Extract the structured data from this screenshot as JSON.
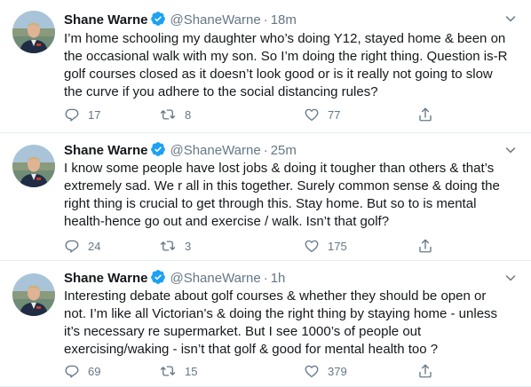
{
  "tweets": [
    {
      "name": "Shane Warne",
      "handle": "@ShaneWarne",
      "separator": "·",
      "time": "18m",
      "lines": [
        "I’m home schooling my daughter who’s doing Y12, stayed home & been on",
        "the occasional walk with my son. So I’m doing the right thing. Question is-R",
        "golf courses closed as it doesn’t look good or is it really not going to slow",
        "the curve if you adhere to the social distancing rules?"
      ],
      "replies": "17",
      "retweets": "8",
      "likes": "77"
    },
    {
      "name": "Shane Warne",
      "handle": "@ShaneWarne",
      "separator": "·",
      "time": "25m",
      "lines": [
        "I know some people have lost jobs & doing it tougher than others & that’s",
        "extremely sad. We r all in this together. Surely common sense & doing the",
        "right thing is crucial to get through this. Stay home. But so to is mental",
        "health-hence go out and exercise / walk. Isn’t that golf?"
      ],
      "replies": "24",
      "retweets": "3",
      "likes": "175"
    },
    {
      "name": "Shane Warne",
      "handle": "@ShaneWarne",
      "separator": "·",
      "time": "1h",
      "lines": [
        "Interesting debate about golf courses & whether they should be open or",
        "not. I’m like all Victorian’s & doing the right thing by staying home - unless",
        "it’s necessary re supermarket. But I see 1000’s of people out",
        "exercising/waking - isn’t that golf & good for mental health too ?"
      ],
      "replies": "69",
      "retweets": "15",
      "likes": "379"
    }
  ],
  "colors": {
    "text": "#14171a",
    "secondary": "#657786",
    "verified": "#1da1f2",
    "divider": "#e6ecf0"
  },
  "icons": {
    "verified": "verified-badge-icon",
    "caret": "chevron-down-icon",
    "reply": "reply-icon",
    "retweet": "retweet-icon",
    "like": "heart-icon",
    "share": "share-icon"
  }
}
